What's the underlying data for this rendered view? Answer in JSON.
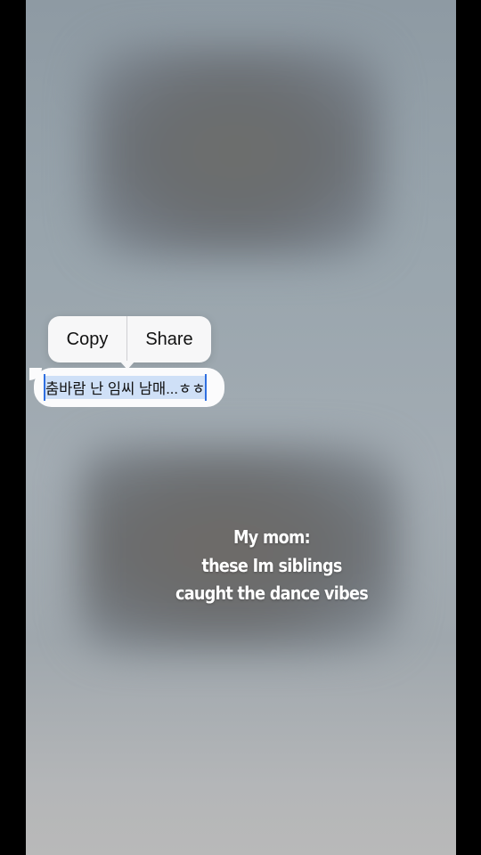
{
  "context_menu": {
    "copy_label": "Copy",
    "share_label": "Share"
  },
  "message": {
    "text": "춤바람 난 임씨 남매...ㅎㅎ"
  },
  "caption": {
    "lines": [
      "My mom:",
      "these Im siblings",
      "caught the dance vibes"
    ]
  },
  "colors": {
    "selection": "#cfe0f7",
    "selection_handle": "#2f6fe0",
    "menu_background": "#f7f7f8",
    "caption_text": "#ffffff"
  }
}
